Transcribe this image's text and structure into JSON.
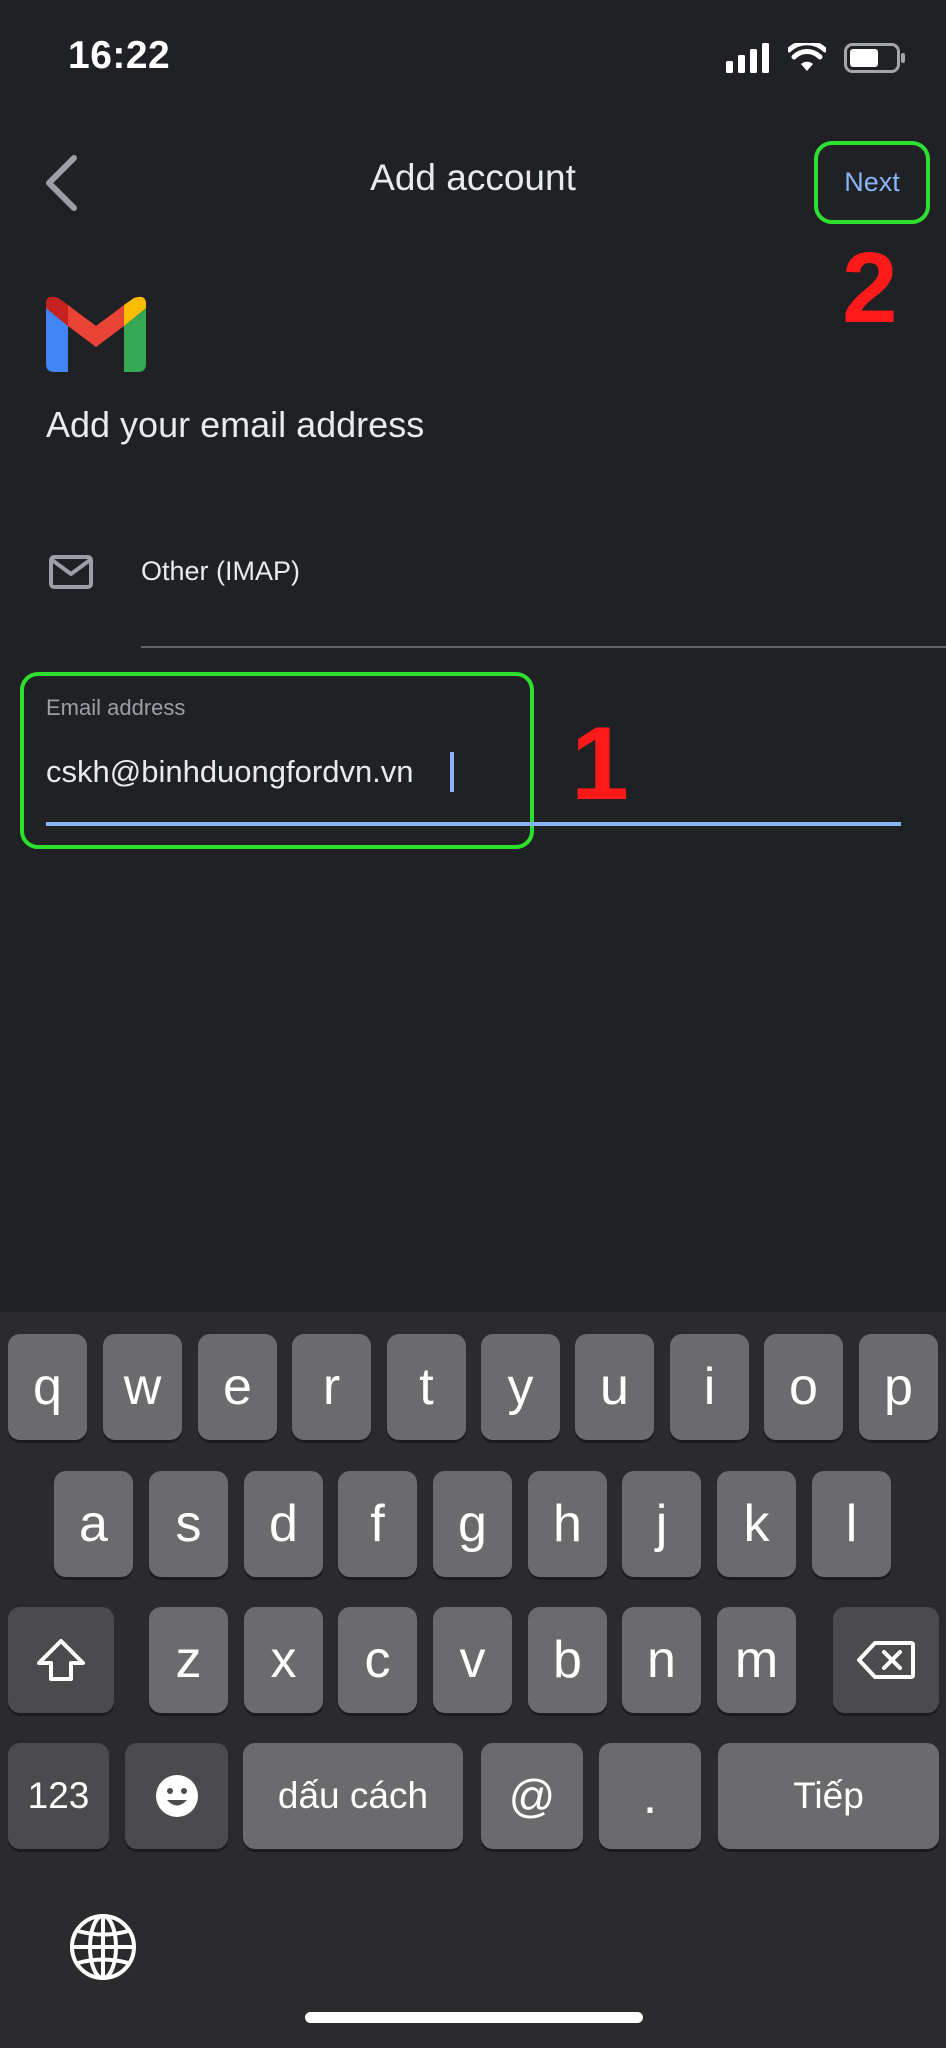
{
  "status_bar": {
    "time": "16:22",
    "icons": [
      "signal-icon",
      "wifi-icon",
      "battery-icon"
    ]
  },
  "nav": {
    "back_icon": "chevron-left-icon",
    "title": "Add account",
    "next_label": "Next"
  },
  "annotations": {
    "step_1": "1",
    "step_2": "2",
    "highlight_color": "#2ee02e",
    "number_color": "#ff1a1a"
  },
  "header": {
    "logo": "gmail-logo",
    "heading": "Add your email address"
  },
  "account_type": {
    "icon": "mail-icon",
    "label": "Other (IMAP)"
  },
  "email_field": {
    "label": "Email address",
    "value": "cskh@binhduongfordvn.vn"
  },
  "colors": {
    "background": "#202124",
    "accent": "#8ab4f8"
  },
  "keyboard": {
    "row1": [
      "q",
      "w",
      "e",
      "r",
      "t",
      "y",
      "u",
      "i",
      "o",
      "p"
    ],
    "row2": [
      "a",
      "s",
      "d",
      "f",
      "g",
      "h",
      "j",
      "k",
      "l"
    ],
    "row3": [
      "z",
      "x",
      "c",
      "v",
      "b",
      "n",
      "m"
    ],
    "shift_icon": "shift-icon",
    "delete_icon": "backspace-icon",
    "numbers_label": "123",
    "emoji_icon": "emoji-icon",
    "space_label": "dấu cách",
    "at_label": "@",
    "dot_label": ".",
    "return_label": "Tiếp",
    "globe_icon": "globe-icon"
  }
}
